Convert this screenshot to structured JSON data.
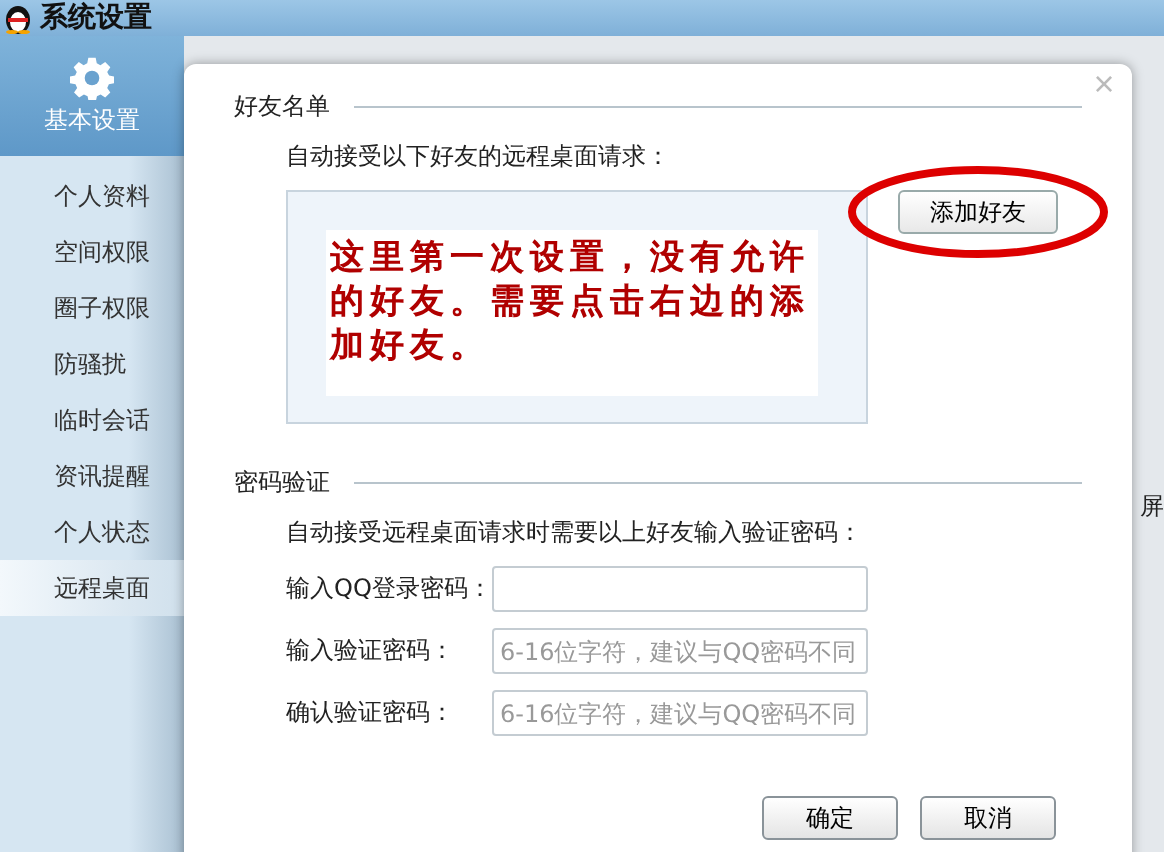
{
  "window": {
    "title": "系统设置"
  },
  "sidebar": {
    "header": "基本设置",
    "items": [
      {
        "label": "个人资料",
        "selected": false
      },
      {
        "label": "空间权限",
        "selected": false
      },
      {
        "label": "圈子权限",
        "selected": false
      },
      {
        "label": "防骚扰",
        "selected": false
      },
      {
        "label": "临时会话",
        "selected": false
      },
      {
        "label": "资讯提醒",
        "selected": false
      },
      {
        "label": "个人状态",
        "selected": false
      },
      {
        "label": "远程桌面",
        "selected": true
      }
    ]
  },
  "background_text": "屏",
  "dialog": {
    "close": "×",
    "friends_section": {
      "title": "好友名单",
      "description": "自动接受以下好友的远程桌面请求：",
      "add_button": "添加好友",
      "annotation": "这里第一次设置，没有允许的好友。需要点击右边的添加好友。"
    },
    "password_section": {
      "title": "密码验证",
      "description": "自动接受远程桌面请求时需要以上好友输入验证密码：",
      "fields": [
        {
          "label": "输入QQ登录密码："
        },
        {
          "label": "输入验证密码：",
          "placeholder": "6-16位字符，建议与QQ密码不同"
        },
        {
          "label": "确认验证密码：",
          "placeholder": "6-16位字符，建议与QQ密码不同"
        }
      ]
    },
    "buttons": [
      "确定",
      "取消"
    ]
  }
}
